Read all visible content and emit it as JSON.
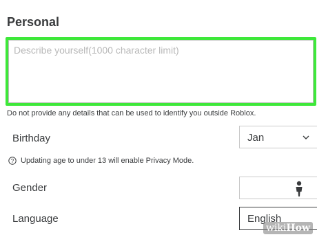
{
  "section": {
    "title": "Personal"
  },
  "about": {
    "placeholder": "Describe yourself(1000 character limit)",
    "value": ""
  },
  "hint_text": "Do not provide any details that can be used to identify you outside Roblox.",
  "birthday": {
    "label": "Birthday",
    "month_value": "Jan"
  },
  "age_note": "Updating age to under 13 will enable Privacy Mode.",
  "gender": {
    "label": "Gender"
  },
  "language": {
    "label": "Language",
    "value": "English"
  },
  "watermark": {
    "part1": "wiki",
    "part2": "How"
  },
  "colors": {
    "highlight": "#3ee83a",
    "text": "#393b3d",
    "placeholder": "#b8b8b8"
  },
  "icons": {
    "chevron": "chevron-down-icon",
    "question": "question-circle-icon",
    "gender": "person-icon"
  }
}
